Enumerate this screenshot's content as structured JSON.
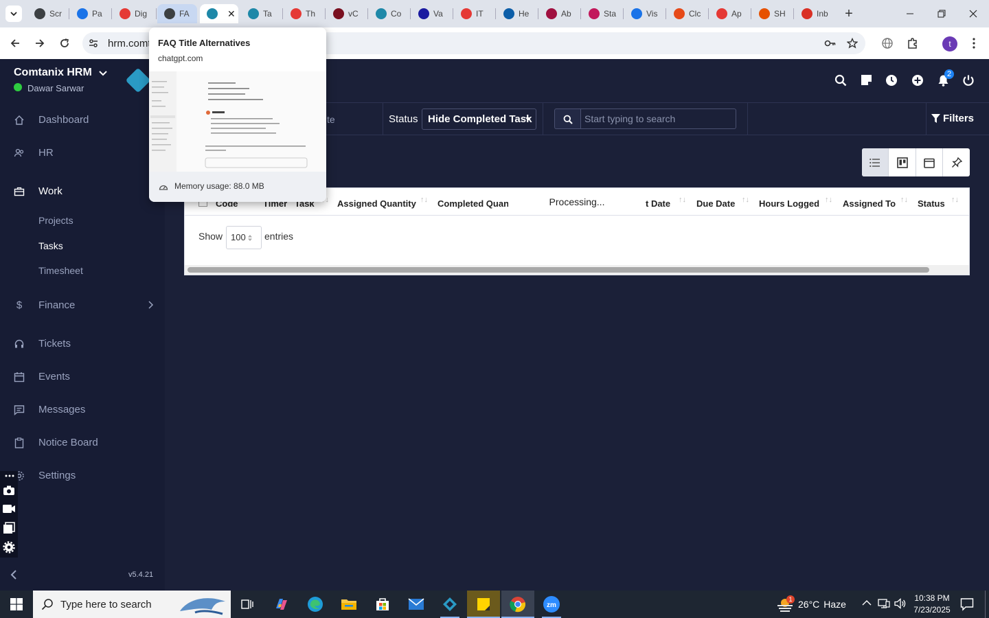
{
  "browser": {
    "tabs": [
      {
        "label": "Scr",
        "color": "#3c4043"
      },
      {
        "label": "Pa",
        "color": "#1a73e8"
      },
      {
        "label": "Dig",
        "color": "#e53935"
      },
      {
        "label": "FA",
        "color": "#3c4043"
      },
      {
        "label": "",
        "color": "#1e88a8"
      },
      {
        "label": "Ta",
        "color": "#1e88a8"
      },
      {
        "label": "Th",
        "color": "#e53935"
      },
      {
        "label": "vC",
        "color": "#7a1020"
      },
      {
        "label": "Co",
        "color": "#1e88a8"
      },
      {
        "label": "Va",
        "color": "#1a1aa0"
      },
      {
        "label": "IT",
        "color": "#e53935"
      },
      {
        "label": "He",
        "color": "#0d5ea8"
      },
      {
        "label": "Ab",
        "color": "#a01040"
      },
      {
        "label": "Sta",
        "color": "#c2185b"
      },
      {
        "label": "Vis",
        "color": "#1a73e8"
      },
      {
        "label": "Clc",
        "color": "#e64a19"
      },
      {
        "label": "Ap",
        "color": "#e53935"
      },
      {
        "label": "SH",
        "color": "#e65100"
      },
      {
        "label": "Inb",
        "color": "#d93025"
      }
    ],
    "new_tab": "+",
    "url": "hrm.comt",
    "profile_initial": "t"
  },
  "preview": {
    "title": "FAQ Title Alternatives",
    "domain": "chatgpt.com",
    "memory": "Memory usage: 88.0 MB"
  },
  "app": {
    "brand": "Comtanix HRM",
    "user": "Dawar Sarwar",
    "version": "v5.4.21",
    "notification_count": "2"
  },
  "sidebar": {
    "dashboard": "Dashboard",
    "hr": "HR",
    "work": "Work",
    "projects": "Projects",
    "tasks": "Tasks",
    "timesheet": "Timesheet",
    "finance": "Finance",
    "tickets": "Tickets",
    "events": "Events",
    "messages": "Messages",
    "notice_board": "Notice Board",
    "settings": "Settings"
  },
  "filters": {
    "partial_label": "te",
    "status_label": "Status",
    "status_value": "Hide Completed Task",
    "search_placeholder": "Start typing to search",
    "filters_button": "Filters"
  },
  "table": {
    "columns": [
      "Code",
      "Timer",
      "Task",
      "Assigned Quantity",
      "Completed Quan",
      "t Date",
      "Due Date",
      "Hours Logged",
      "Assigned To",
      "Status"
    ],
    "processing": "Processing...",
    "show_label": "Show",
    "entries_value": "100",
    "entries_label": "entries"
  },
  "taskbar": {
    "search_placeholder": "Type here to search",
    "weather_temp": "26°C",
    "weather_desc": "Haze",
    "weather_badge": "1",
    "time": "10:38 PM",
    "date": "7/23/2025"
  }
}
